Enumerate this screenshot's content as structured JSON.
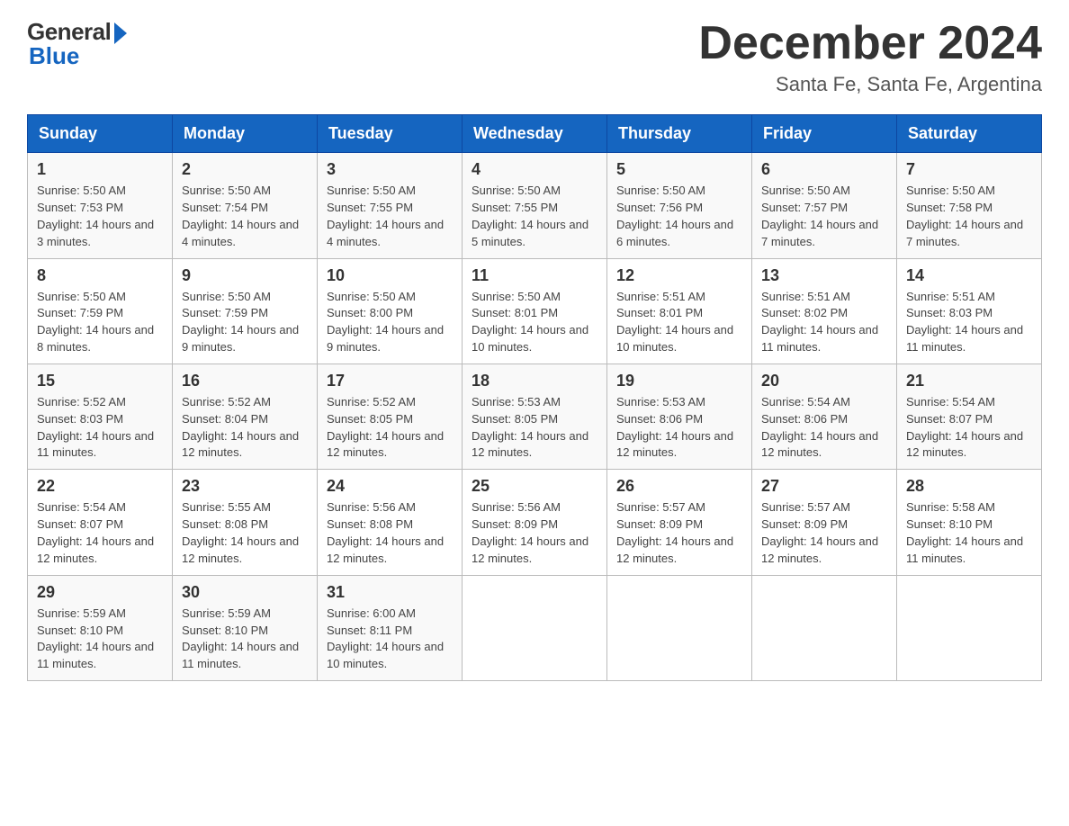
{
  "header": {
    "logo_general": "General",
    "logo_blue": "Blue",
    "month_title": "December 2024",
    "location": "Santa Fe, Santa Fe, Argentina"
  },
  "weekdays": [
    "Sunday",
    "Monday",
    "Tuesday",
    "Wednesday",
    "Thursday",
    "Friday",
    "Saturday"
  ],
  "weeks": [
    [
      {
        "day": "1",
        "sunrise": "5:50 AM",
        "sunset": "7:53 PM",
        "daylight": "14 hours and 3 minutes."
      },
      {
        "day": "2",
        "sunrise": "5:50 AM",
        "sunset": "7:54 PM",
        "daylight": "14 hours and 4 minutes."
      },
      {
        "day": "3",
        "sunrise": "5:50 AM",
        "sunset": "7:55 PM",
        "daylight": "14 hours and 4 minutes."
      },
      {
        "day": "4",
        "sunrise": "5:50 AM",
        "sunset": "7:55 PM",
        "daylight": "14 hours and 5 minutes."
      },
      {
        "day": "5",
        "sunrise": "5:50 AM",
        "sunset": "7:56 PM",
        "daylight": "14 hours and 6 minutes."
      },
      {
        "day": "6",
        "sunrise": "5:50 AM",
        "sunset": "7:57 PM",
        "daylight": "14 hours and 7 minutes."
      },
      {
        "day": "7",
        "sunrise": "5:50 AM",
        "sunset": "7:58 PM",
        "daylight": "14 hours and 7 minutes."
      }
    ],
    [
      {
        "day": "8",
        "sunrise": "5:50 AM",
        "sunset": "7:59 PM",
        "daylight": "14 hours and 8 minutes."
      },
      {
        "day": "9",
        "sunrise": "5:50 AM",
        "sunset": "7:59 PM",
        "daylight": "14 hours and 9 minutes."
      },
      {
        "day": "10",
        "sunrise": "5:50 AM",
        "sunset": "8:00 PM",
        "daylight": "14 hours and 9 minutes."
      },
      {
        "day": "11",
        "sunrise": "5:50 AM",
        "sunset": "8:01 PM",
        "daylight": "14 hours and 10 minutes."
      },
      {
        "day": "12",
        "sunrise": "5:51 AM",
        "sunset": "8:01 PM",
        "daylight": "14 hours and 10 minutes."
      },
      {
        "day": "13",
        "sunrise": "5:51 AM",
        "sunset": "8:02 PM",
        "daylight": "14 hours and 11 minutes."
      },
      {
        "day": "14",
        "sunrise": "5:51 AM",
        "sunset": "8:03 PM",
        "daylight": "14 hours and 11 minutes."
      }
    ],
    [
      {
        "day": "15",
        "sunrise": "5:52 AM",
        "sunset": "8:03 PM",
        "daylight": "14 hours and 11 minutes."
      },
      {
        "day": "16",
        "sunrise": "5:52 AM",
        "sunset": "8:04 PM",
        "daylight": "14 hours and 12 minutes."
      },
      {
        "day": "17",
        "sunrise": "5:52 AM",
        "sunset": "8:05 PM",
        "daylight": "14 hours and 12 minutes."
      },
      {
        "day": "18",
        "sunrise": "5:53 AM",
        "sunset": "8:05 PM",
        "daylight": "14 hours and 12 minutes."
      },
      {
        "day": "19",
        "sunrise": "5:53 AM",
        "sunset": "8:06 PM",
        "daylight": "14 hours and 12 minutes."
      },
      {
        "day": "20",
        "sunrise": "5:54 AM",
        "sunset": "8:06 PM",
        "daylight": "14 hours and 12 minutes."
      },
      {
        "day": "21",
        "sunrise": "5:54 AM",
        "sunset": "8:07 PM",
        "daylight": "14 hours and 12 minutes."
      }
    ],
    [
      {
        "day": "22",
        "sunrise": "5:54 AM",
        "sunset": "8:07 PM",
        "daylight": "14 hours and 12 minutes."
      },
      {
        "day": "23",
        "sunrise": "5:55 AM",
        "sunset": "8:08 PM",
        "daylight": "14 hours and 12 minutes."
      },
      {
        "day": "24",
        "sunrise": "5:56 AM",
        "sunset": "8:08 PM",
        "daylight": "14 hours and 12 minutes."
      },
      {
        "day": "25",
        "sunrise": "5:56 AM",
        "sunset": "8:09 PM",
        "daylight": "14 hours and 12 minutes."
      },
      {
        "day": "26",
        "sunrise": "5:57 AM",
        "sunset": "8:09 PM",
        "daylight": "14 hours and 12 minutes."
      },
      {
        "day": "27",
        "sunrise": "5:57 AM",
        "sunset": "8:09 PM",
        "daylight": "14 hours and 12 minutes."
      },
      {
        "day": "28",
        "sunrise": "5:58 AM",
        "sunset": "8:10 PM",
        "daylight": "14 hours and 11 minutes."
      }
    ],
    [
      {
        "day": "29",
        "sunrise": "5:59 AM",
        "sunset": "8:10 PM",
        "daylight": "14 hours and 11 minutes."
      },
      {
        "day": "30",
        "sunrise": "5:59 AM",
        "sunset": "8:10 PM",
        "daylight": "14 hours and 11 minutes."
      },
      {
        "day": "31",
        "sunrise": "6:00 AM",
        "sunset": "8:11 PM",
        "daylight": "14 hours and 10 minutes."
      },
      null,
      null,
      null,
      null
    ]
  ]
}
